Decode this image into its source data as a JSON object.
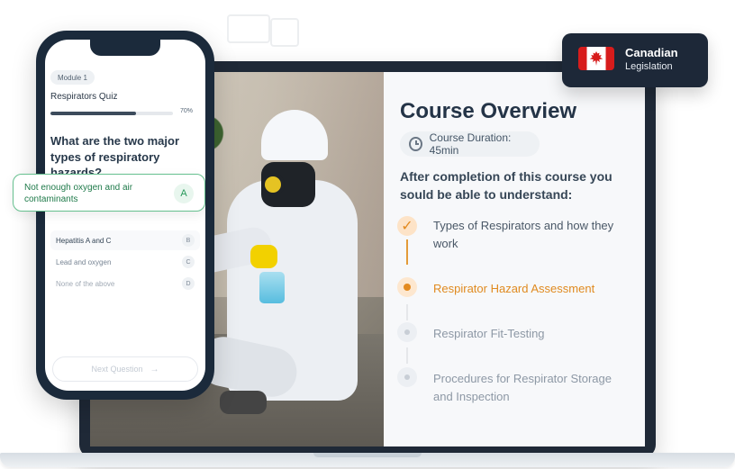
{
  "top_hint": {
    "line1": "",
    "line2": ""
  },
  "badge": {
    "title": "Canadian",
    "subtitle": "Legislation"
  },
  "phone": {
    "module": "Module 1",
    "quiz_title": "Respirators Quiz",
    "progress_percent": 70,
    "progress_text": "70%",
    "question": "What are the two major types of respiratory hazards?",
    "selected_answer": {
      "text": "Not enough oxygen and air contaminants",
      "letter": "A"
    },
    "answers": [
      {
        "text": "Hepatitis A and C",
        "letter": "B"
      },
      {
        "text": "Lead and oxygen",
        "letter": "C"
      },
      {
        "text": "None of the above",
        "letter": "D"
      }
    ],
    "next_button": "Next Question"
  },
  "course": {
    "title": "Course Overview",
    "duration": "Course Duration: 45min",
    "intro": "After completion of this course you sould be able to understand:",
    "steps": [
      {
        "label": "Types of Respirators and how they work",
        "state": "completed"
      },
      {
        "label": "Respirator Hazard Assessment",
        "state": "current"
      },
      {
        "label": "Respirator Fit-Testing",
        "state": "upcoming"
      },
      {
        "label": "Procedures for Respirator Storage and Inspection",
        "state": "upcoming"
      }
    ]
  },
  "colors": {
    "accent": "#E38A1F",
    "success": "#27995A",
    "dark": "#1D2838"
  }
}
